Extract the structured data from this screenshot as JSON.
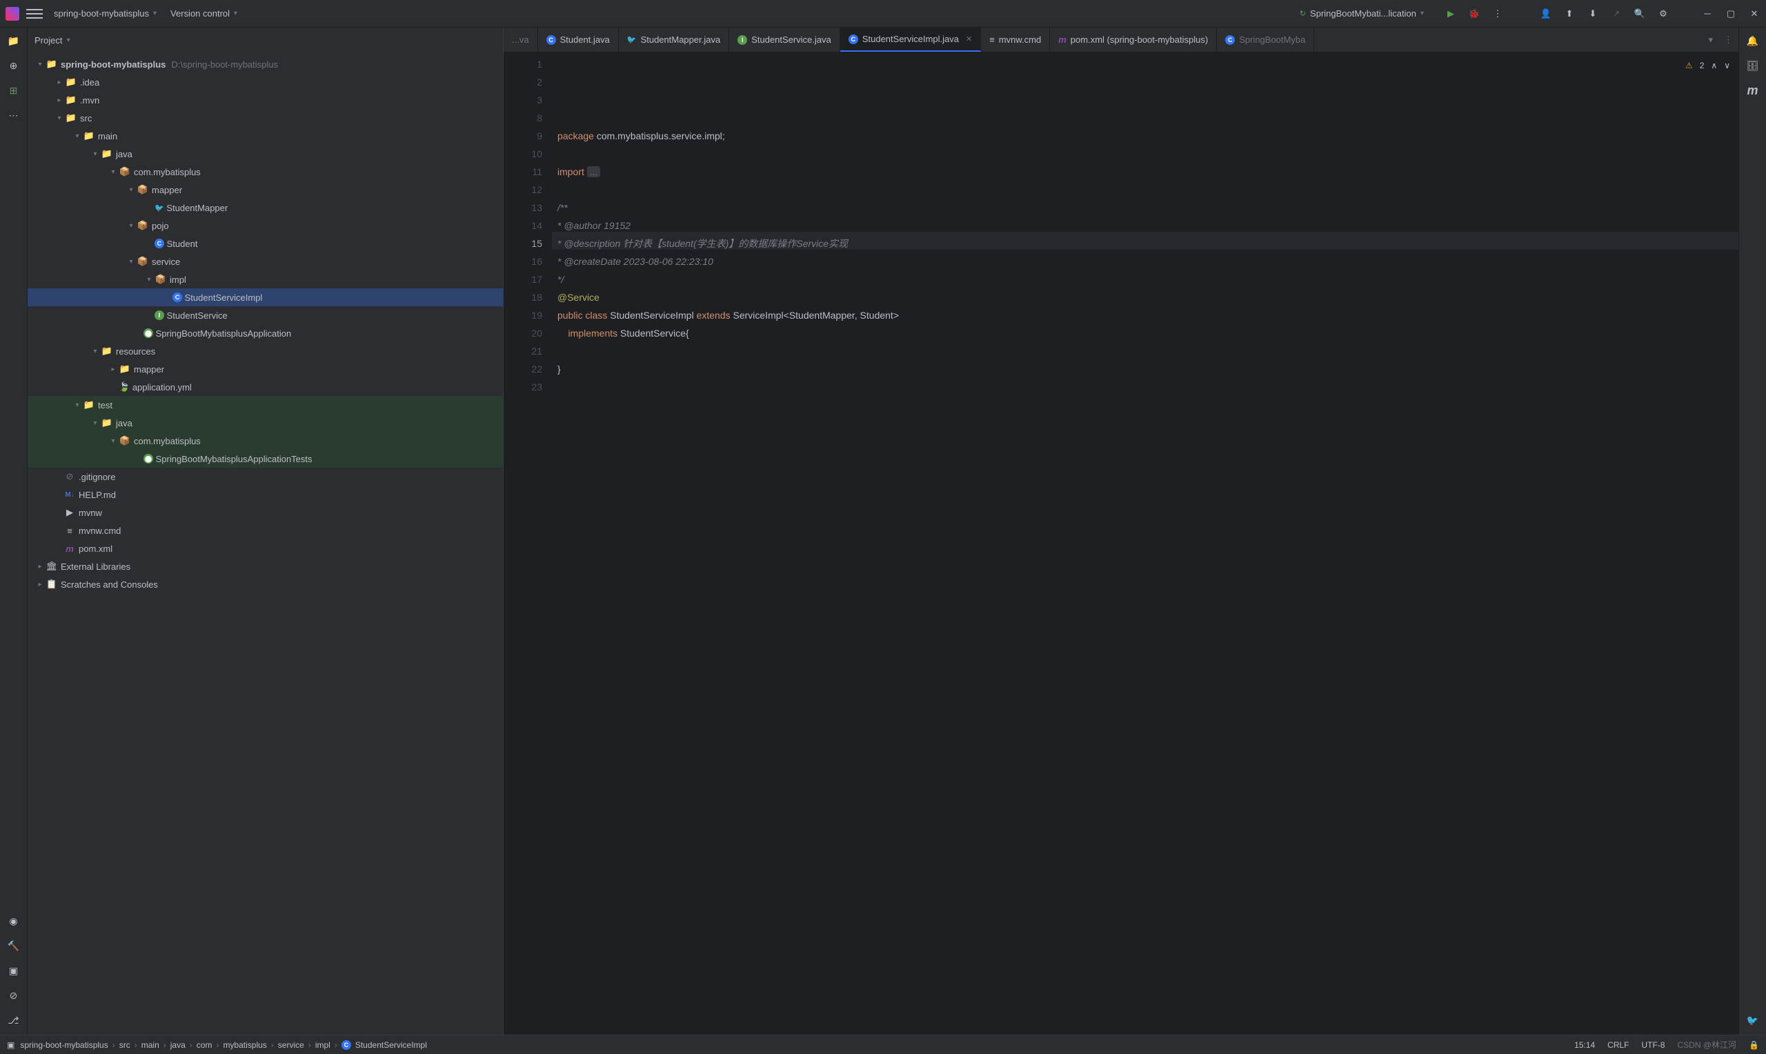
{
  "top": {
    "project": "spring-boot-mybatisplus",
    "vc": "Version control",
    "runcfg": "SpringBootMybati...lication"
  },
  "sidebar": {
    "header": "Project",
    "root": {
      "name": "spring-boot-mybatisplus",
      "path": "D:\\spring-boot-mybatisplus"
    },
    "tree": {
      "idea": ".idea",
      "mvn": ".mvn",
      "src": "src",
      "main": "main",
      "java": "java",
      "pkg": "com.mybatisplus",
      "mapper": "mapper",
      "studentmapper": "StudentMapper",
      "pojo": "pojo",
      "student": "Student",
      "service": "service",
      "impl": "impl",
      "ssi": "StudentServiceImpl",
      "ss": "StudentService",
      "app": "SpringBootMybatisplusApplication",
      "resources": "resources",
      "mapperf": "mapper",
      "appyml": "application.yml",
      "test": "test",
      "java2": "java",
      "pkg2": "com.mybatisplus",
      "apptest": "SpringBootMybatisplusApplicationTests",
      "gitignore": ".gitignore",
      "help": "HELP.md",
      "mvnw": "mvnw",
      "mvnwcmd": "mvnw.cmd",
      "pom": "pom.xml",
      "extlib": "External Libraries",
      "scratch": "Scratches and Consoles"
    }
  },
  "tabs": [
    {
      "label": "...va",
      "icon": "",
      "partial": true
    },
    {
      "label": "Student.java",
      "icon": "C"
    },
    {
      "label": "StudentMapper.java",
      "icon": "mvn"
    },
    {
      "label": "StudentService.java",
      "icon": "I"
    },
    {
      "label": "StudentServiceImpl.java",
      "icon": "C",
      "active": true,
      "close": true
    },
    {
      "label": "mvnw.cmd",
      "icon": "≡"
    },
    {
      "label": "pom.xml (spring-boot-mybatisplus)",
      "icon": "m"
    },
    {
      "label": "SpringBootMyba",
      "icon": "C",
      "partial": true
    }
  ],
  "code": {
    "l1": "package com.mybatisplus.service.impl;",
    "l3a": "import ",
    "l3b": "...",
    "l8": "/**",
    "l9": "* @author 19152",
    "l10": "* @description 针对表【student(学生表)】的数据库操作Service实现",
    "l11": "* @createDate 2023-08-06 22:23:10",
    "l12": "*/",
    "l13": "@Service",
    "l14a": "public",
    "l14b": "class",
    "l14c": "StudentServiceImpl",
    "l14d": "extends",
    "l14e": "ServiceImpl<StudentMapper, Student>",
    "l15a": "    implements ",
    "l15b": "StudentService{",
    "l17": "}",
    "warn": "2"
  },
  "gutter": [
    1,
    2,
    3,
    8,
    9,
    10,
    11,
    12,
    13,
    14,
    15,
    16,
    17,
    18,
    19,
    20,
    21,
    22,
    23
  ],
  "breadcrumb": [
    "spring-boot-mybatisplus",
    "src",
    "main",
    "java",
    "com",
    "mybatisplus",
    "service",
    "impl",
    "StudentServiceImpl"
  ],
  "status": {
    "pos": "15:14",
    "sep": "CRLF",
    "enc": "UTF-8",
    "watermark": "CSDN @林江河"
  }
}
